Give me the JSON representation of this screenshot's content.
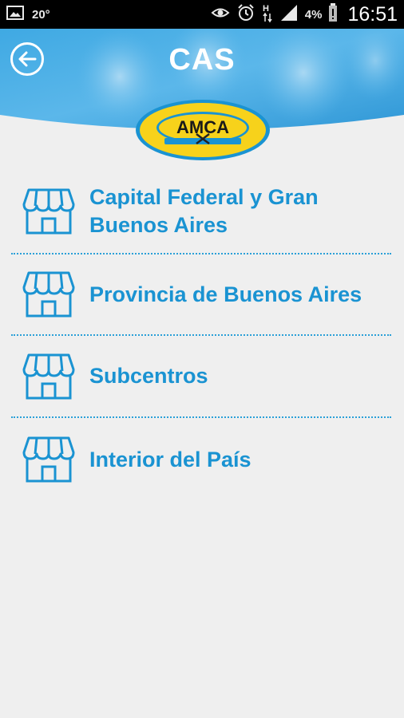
{
  "status_bar": {
    "temperature": "20°",
    "battery_percent": "4%",
    "time": "16:51",
    "icons": [
      "image-icon",
      "eye-icon",
      "alarm-icon",
      "data-h-icon",
      "signal-icon",
      "battery-icon"
    ]
  },
  "header": {
    "title": "CAS",
    "back_icon": "back-arrow-icon",
    "accent_color": "#2aa0d8"
  },
  "logo": {
    "text": "AMCA",
    "colors": {
      "yellow": "#f7d21b",
      "blue": "#1a93d2"
    }
  },
  "menu": {
    "items": [
      {
        "label": "Capital Federal y Gran Buenos Aires",
        "icon": "store-icon"
      },
      {
        "label": "Provincia de Buenos Aires",
        "icon": "store-icon"
      },
      {
        "label": "Subcentros",
        "icon": "store-icon"
      },
      {
        "label": "Interior del País",
        "icon": "store-icon"
      }
    ]
  }
}
